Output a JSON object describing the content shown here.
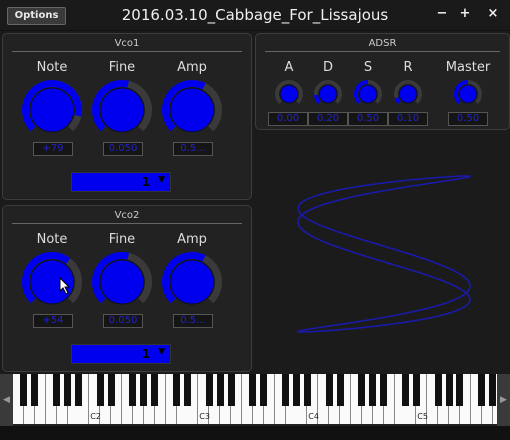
{
  "window": {
    "title": "2016.03.10_Cabbage_For_Lissajous",
    "options_label": "Options",
    "minimize": "−",
    "maximize": "+",
    "close": "×"
  },
  "vco1": {
    "title": "Vco1",
    "knobs": [
      {
        "label": "Note",
        "value": "+79",
        "level": 0.88
      },
      {
        "label": "Fine",
        "value": "0.050",
        "level": 0.55
      },
      {
        "label": "Amp",
        "value": "0.5...",
        "level": 0.6
      }
    ],
    "combo_value": "1"
  },
  "vco2": {
    "title": "Vco2",
    "knobs": [
      {
        "label": "Note",
        "value": "+54",
        "level": 0.64
      },
      {
        "label": "Fine",
        "value": "0.050",
        "level": 0.55
      },
      {
        "label": "Amp",
        "value": "0.5...",
        "level": 0.6
      }
    ],
    "combo_value": "1"
  },
  "adsr": {
    "title": "ADSR",
    "knobs": [
      {
        "label": "A",
        "value": "0.00",
        "level": 0.0
      },
      {
        "label": "D",
        "value": "0.20",
        "level": 0.15
      },
      {
        "label": "S",
        "value": "0.50",
        "level": 0.5
      },
      {
        "label": "R",
        "value": "0.10",
        "level": 0.1
      },
      {
        "label": "Master",
        "value": "0.50",
        "level": 0.5
      }
    ]
  },
  "keyboard": {
    "labels": [
      "C2",
      "C3",
      "C4",
      "C5"
    ],
    "left_arrow": "◀",
    "right_arrow": "▶"
  },
  "colors": {
    "accent": "#0000ee",
    "knob_track": "#3a3a3a",
    "scope_line": "#1a1aa8"
  }
}
